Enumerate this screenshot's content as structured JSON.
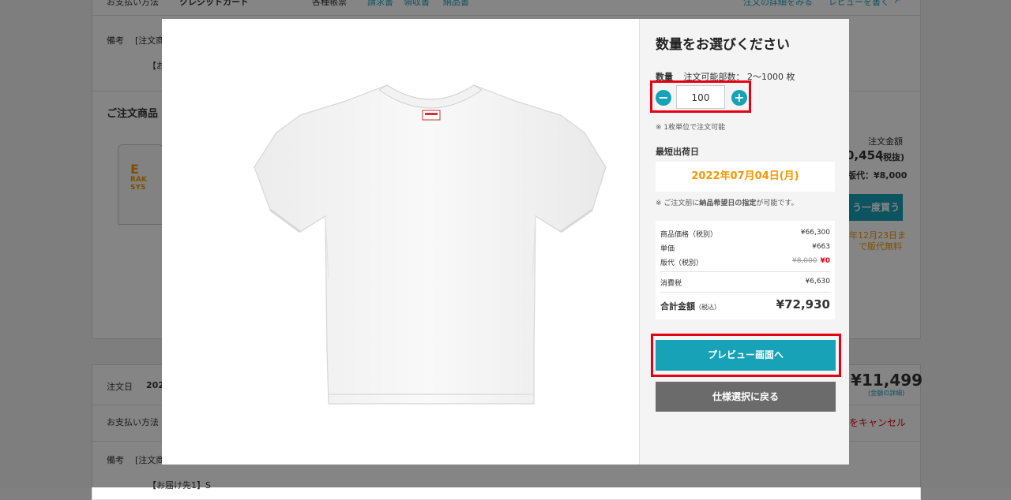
{
  "background": {
    "order1": {
      "payment_label": "お支払い方法",
      "payment_value": "クレジットカード",
      "documents_label": "各種帳票",
      "doc_invoice": "請求書",
      "doc_receipt": "領収書",
      "doc_delivery": "納品書",
      "detail_link": "注文の詳細をみる",
      "review_link": "レビューを書く",
      "remarks_label": "備考",
      "remarks_value": "[注文商",
      "remarks_line2": "【お",
      "products_heading": "ご注文商品",
      "thumb_logo_1": "E",
      "thumb_logo_2": "RAK",
      "thumb_logo_3": "SYS",
      "order_amount_label": "注文金額",
      "order_amount_value": "0,454",
      "order_amount_tax": "(税抜)",
      "plate_fee": "版代：¥8,000",
      "reorder_button": "う一度買う",
      "free_plate_note_1": "年12月23日ま",
      "free_plate_note_2": "で版代無料"
    },
    "order2": {
      "date_label": "注文日",
      "date_value": "202",
      "total": "¥11,499",
      "amount_detail": "(金額の詳細)",
      "payment_label": "お支払い方法",
      "cancel_link": "をキャンセル",
      "remarks_label": "備考",
      "remarks_value": "[注文商",
      "delivery_line": "【お届け先1】S"
    }
  },
  "modal": {
    "title": "数量をお選びください",
    "quantity_label": "数量",
    "quantity_range": "注文可能部数： 2〜1000 枚",
    "quantity_value": "100",
    "minus_symbol": "−",
    "plus_symbol": "+",
    "unit_note": "※ 1枚単位で注文可能",
    "shipping_label": "最短出荷日",
    "shipping_date": "2022年07月04日(月)",
    "delivery_note_prefix": "※ ご注文前に",
    "delivery_note_bold": "納品希望日の指定",
    "delivery_note_suffix": "が可能です。",
    "price": {
      "product_price_label": "商品価格（税別）",
      "product_price_value": "¥66,300",
      "unit_price_label": "単価",
      "unit_price_value": "¥663",
      "plate_label": "版代（税別）",
      "plate_original": "¥8,000",
      "plate_value": "¥0",
      "tax_label": "消費税",
      "tax_value": "¥6,630",
      "total_label": "合計金額",
      "total_tax_note": "（税込）",
      "total_value": "¥72,930"
    },
    "preview_button": "プレビュー画面へ",
    "back_button": "仕様選択に戻る"
  },
  "colors": {
    "accent_teal": "#17a2b8",
    "highlight_red": "#e60012",
    "date_orange": "#f39800",
    "back_button_gray": "#6b6b6b"
  },
  "icons": {
    "minus": "minus-circle-icon",
    "plus": "plus-circle-icon",
    "external_link": "external-link-icon",
    "product_image": "tshirt-image"
  }
}
